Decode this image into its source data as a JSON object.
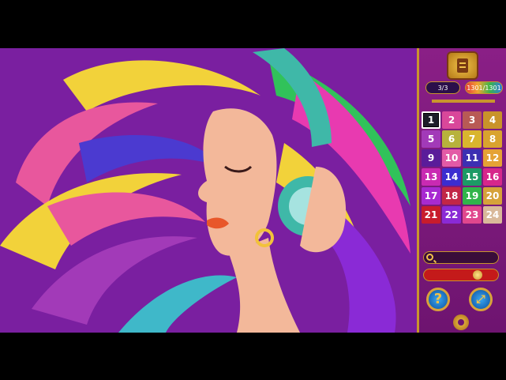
{
  "panel": {
    "pages_label": "3/3",
    "score_label": "1301/1301",
    "search_progress": 0,
    "slider_level": 0.75
  },
  "palette": {
    "selected": 1,
    "swatches": [
      {
        "label": "1",
        "color": "#1d1d2a"
      },
      {
        "label": "2",
        "color": "#d9479a"
      },
      {
        "label": "3",
        "color": "#b85a55"
      },
      {
        "label": "4",
        "color": "#c9932a"
      },
      {
        "label": "5",
        "color": "#a23ab8"
      },
      {
        "label": "6",
        "color": "#b7b23c"
      },
      {
        "label": "7",
        "color": "#d9b52e"
      },
      {
        "label": "8",
        "color": "#d9a32e"
      },
      {
        "label": "9",
        "color": "#5a1c9a"
      },
      {
        "label": "10",
        "color": "#e35aa6"
      },
      {
        "label": "11",
        "color": "#3c2fb2"
      },
      {
        "label": "12",
        "color": "#e5a235"
      },
      {
        "label": "13",
        "color": "#c92ab2"
      },
      {
        "label": "14",
        "color": "#3b2dd0"
      },
      {
        "label": "15",
        "color": "#1c9a66"
      },
      {
        "label": "16",
        "color": "#d6278b"
      },
      {
        "label": "17",
        "color": "#a82ad1"
      },
      {
        "label": "18",
        "color": "#c22646"
      },
      {
        "label": "19",
        "color": "#31b54a"
      },
      {
        "label": "20",
        "color": "#d6a23a"
      },
      {
        "label": "21",
        "color": "#c81c2c"
      },
      {
        "label": "22",
        "color": "#8a2ad6"
      },
      {
        "label": "23",
        "color": "#e0478d"
      },
      {
        "label": "24",
        "color": "#d9b99a"
      }
    ]
  },
  "buttons": {
    "help_label": "?",
    "expand_label": "⤢"
  },
  "icons": {
    "book": "book-icon",
    "search": "search-icon",
    "gear": "gear-icon"
  }
}
